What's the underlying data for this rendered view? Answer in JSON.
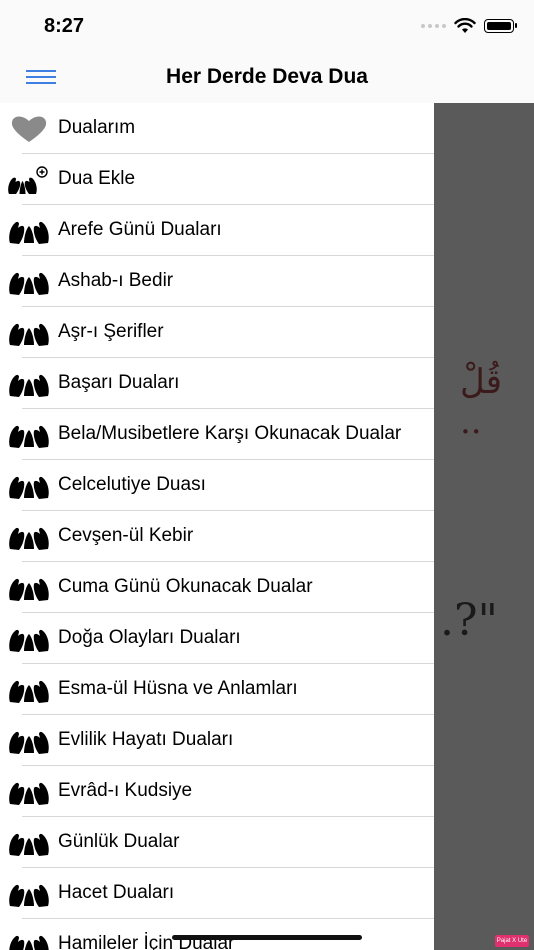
{
  "status_bar": {
    "time": "8:27"
  },
  "nav_bar": {
    "title": "Her Derde Deva Dua"
  },
  "background": {
    "arabic_text": "قُلْ ..",
    "quote_text": ".?\""
  },
  "menu": {
    "items": [
      {
        "label": "Dualarım",
        "icon": "heart-icon"
      },
      {
        "label": "Dua Ekle",
        "icon": "praying-hands-add-icon"
      },
      {
        "label": "Arefe Günü Duaları",
        "icon": "praying-hands-icon"
      },
      {
        "label": "Ashab-ı Bedir",
        "icon": "praying-hands-icon"
      },
      {
        "label": "Aşr-ı Şerifler",
        "icon": "praying-hands-icon"
      },
      {
        "label": "Başarı Duaları",
        "icon": "praying-hands-icon"
      },
      {
        "label": "Bela/Musibetlere Karşı Okunacak Dualar",
        "icon": "praying-hands-icon"
      },
      {
        "label": "Celcelutiye Duası",
        "icon": "praying-hands-icon"
      },
      {
        "label": "Cevşen-ül Kebir",
        "icon": "praying-hands-icon"
      },
      {
        "label": "Cuma Günü Okunacak Dualar",
        "icon": "praying-hands-icon"
      },
      {
        "label": "Doğa Olayları Duaları",
        "icon": "praying-hands-icon"
      },
      {
        "label": "Esma-ül Hüsna ve Anlamları",
        "icon": "praying-hands-icon"
      },
      {
        "label": "Evlilik Hayatı Duaları",
        "icon": "praying-hands-icon"
      },
      {
        "label": "Evrâd-ı Kudsiye",
        "icon": "praying-hands-icon"
      },
      {
        "label": "Günlük Dualar",
        "icon": "praying-hands-icon"
      },
      {
        "label": "Hacet Duaları",
        "icon": "praying-hands-icon"
      },
      {
        "label": "Hamileler İçin Dualar",
        "icon": "praying-hands-icon"
      }
    ]
  },
  "badge": {
    "text": "Pajat X Ute"
  },
  "colors": {
    "accent": "#3e7fe3",
    "backdrop": "#5a5a5a"
  }
}
